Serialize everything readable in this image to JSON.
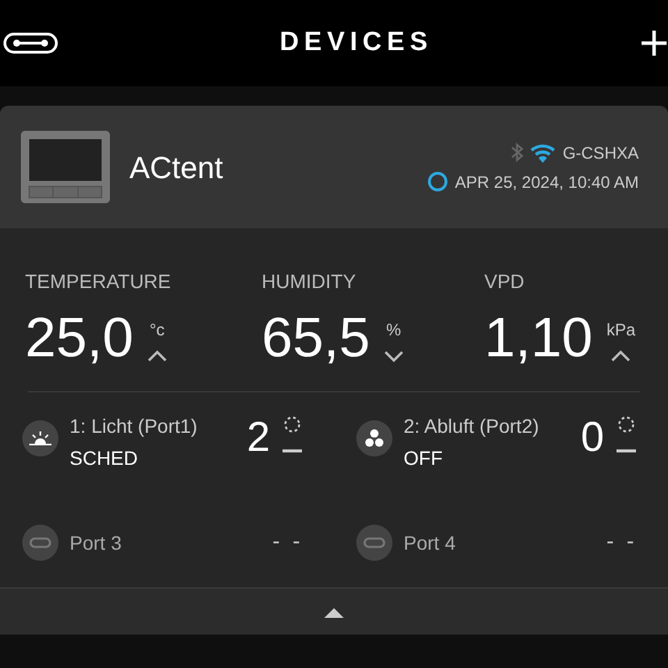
{
  "header": {
    "title": "DEVICES"
  },
  "device": {
    "name": "ACtent",
    "wifi_name": "G-CSHXA",
    "timestamp": "APR 25, 2024, 10:40 AM"
  },
  "metrics": [
    {
      "label": "TEMPERATURE",
      "value": "25,0",
      "unit": "°c",
      "kind": "rising"
    },
    {
      "label": "HUMIDITY",
      "value": "65,5",
      "unit": "%",
      "kind": "falling"
    },
    {
      "label": "VPD",
      "value": "1,10",
      "unit": "kPa",
      "kind": "rising"
    }
  ],
  "ports": [
    {
      "kind": "light",
      "name": "1: Licht (Port1)",
      "mode": "SCHED",
      "level_text": "2"
    },
    {
      "kind": "fan",
      "name": "2: Abluft (Port2)",
      "mode": "OFF",
      "level_text": "0"
    },
    {
      "kind": "empty",
      "name": "Port 3",
      "level_text": "- -"
    },
    {
      "kind": "empty",
      "name": "Port 4",
      "level_text": "- -"
    }
  ]
}
